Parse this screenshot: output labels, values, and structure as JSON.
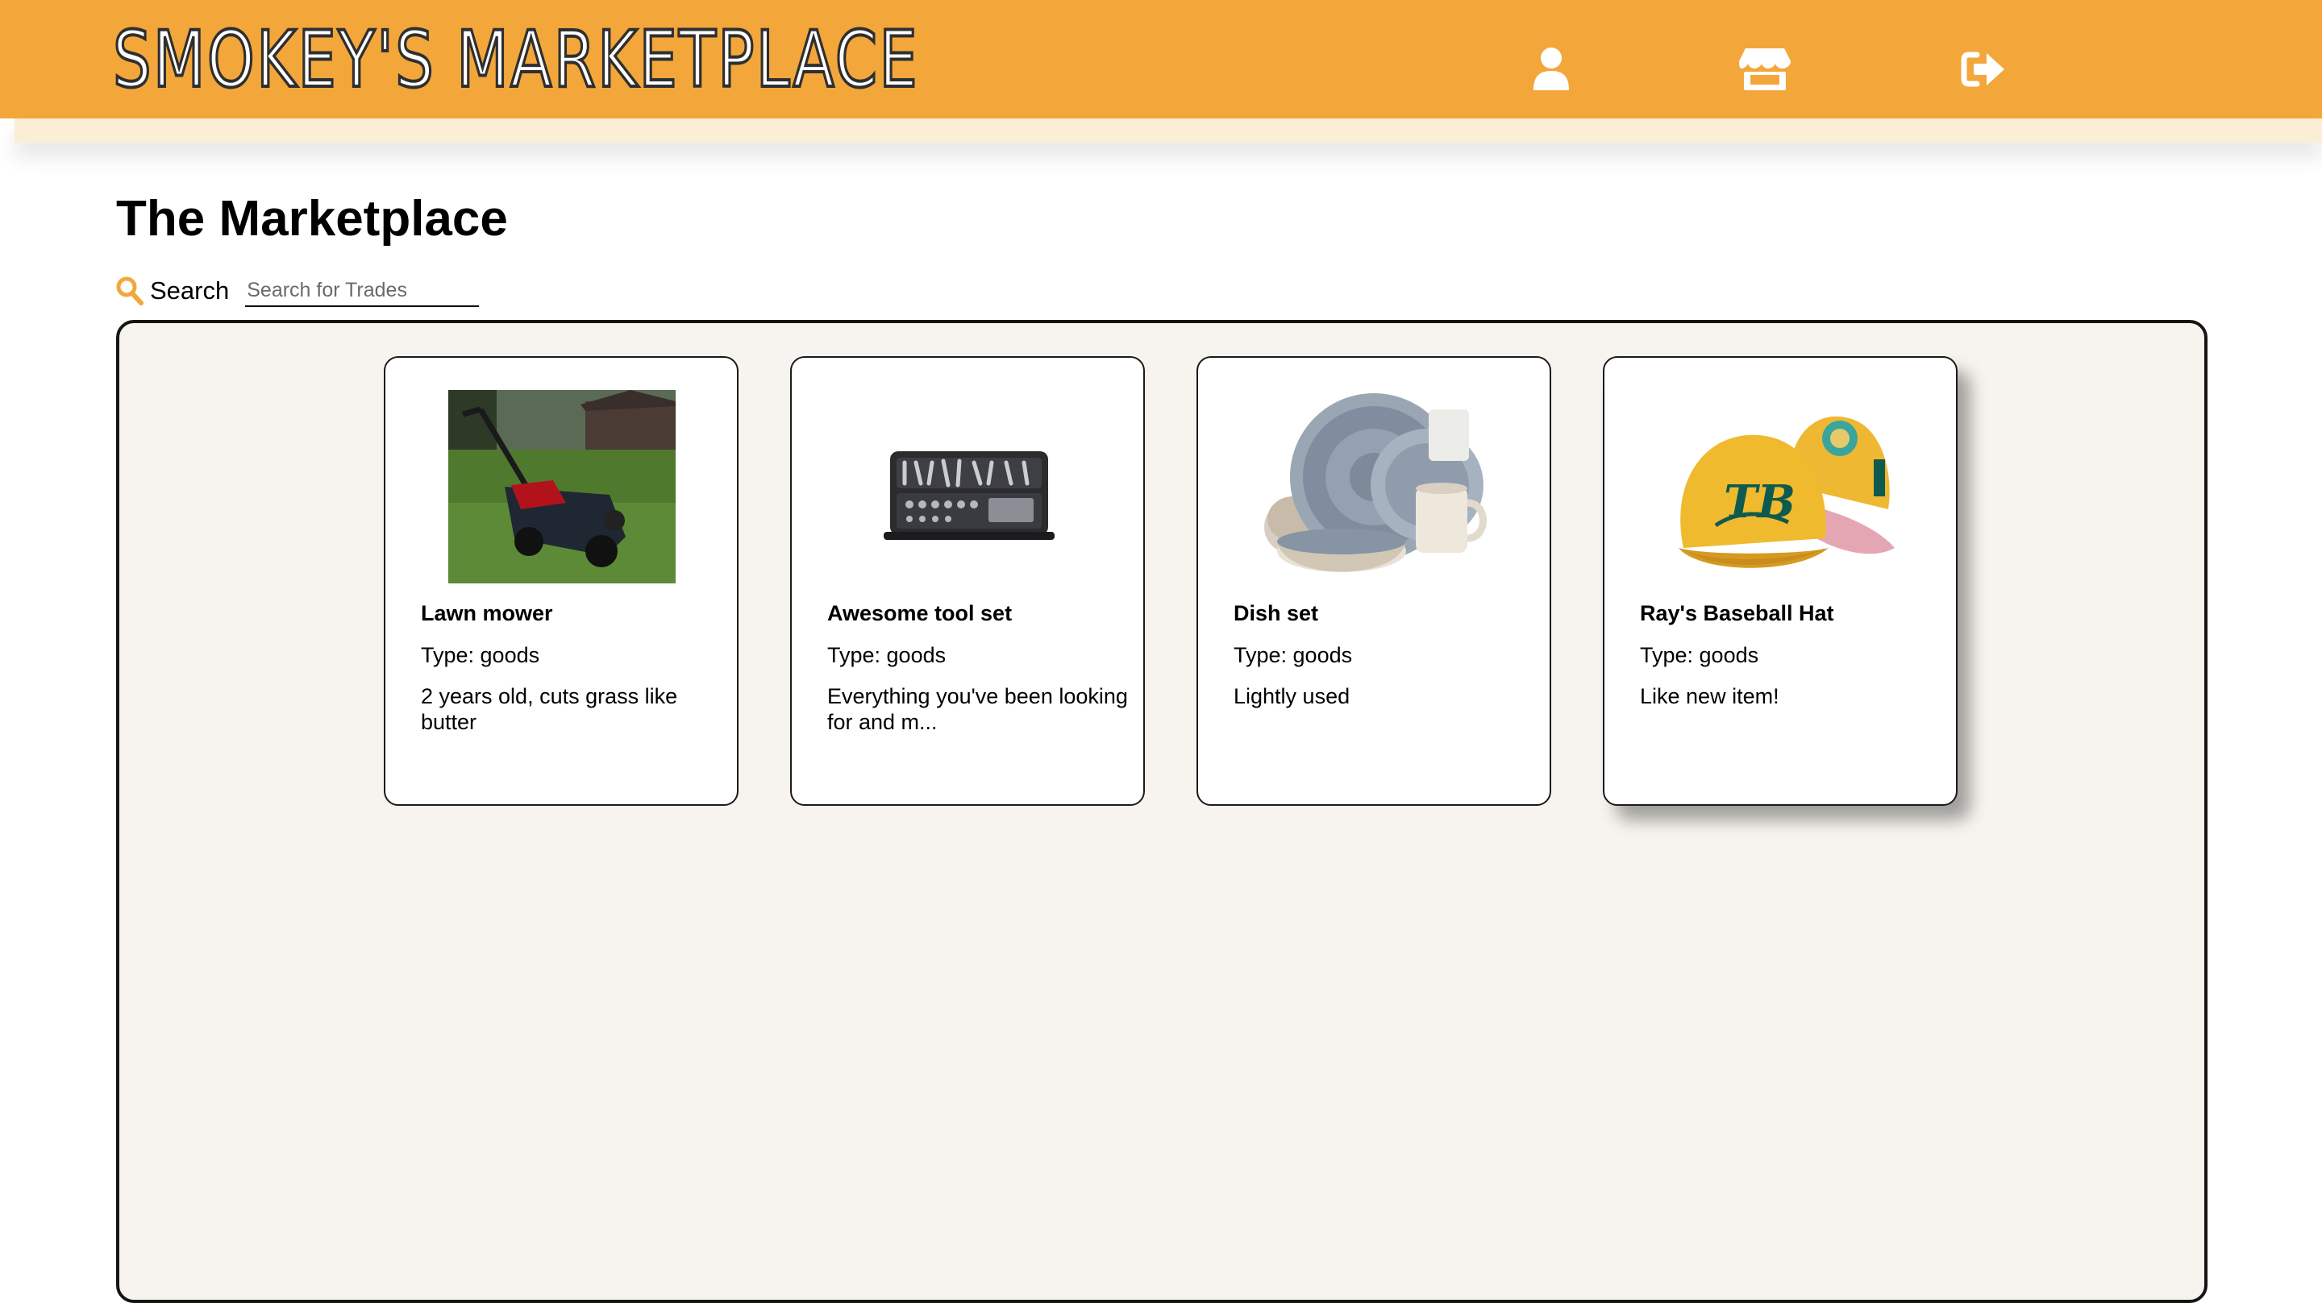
{
  "header": {
    "brand": "SMOKEY'S MARKETPLACE",
    "background_color": "#f3a73b",
    "nav": [
      {
        "name": "profile",
        "icon": "user-icon"
      },
      {
        "name": "store",
        "icon": "storefront-icon"
      },
      {
        "name": "logout",
        "icon": "sign-out-icon"
      }
    ]
  },
  "main": {
    "title": "The Marketplace",
    "search": {
      "label": "Search",
      "placeholder": "Search for Trades",
      "value": "",
      "icon": "search-icon"
    }
  },
  "listings": [
    {
      "title": "Lawn mower",
      "type": "Type: goods",
      "description": "2 years old, cuts grass like butter",
      "image": "lawn-mower-photo"
    },
    {
      "title": "Awesome tool set",
      "type": "Type: goods",
      "description": "Everything you've been looking for and m...",
      "image": "tool-set-photo"
    },
    {
      "title": "Dish set",
      "type": "Type: goods",
      "description": "Lightly used",
      "image": "dish-set-photo"
    },
    {
      "title": "Ray's Baseball Hat",
      "type": "Type: goods",
      "description": "Like new item!",
      "image": "baseball-hat-photo"
    }
  ],
  "colors": {
    "accent": "#f3a73b",
    "header_strip": "#fbeed6",
    "board_background": "#f7f4ef",
    "search_icon": "#f3a73b"
  }
}
